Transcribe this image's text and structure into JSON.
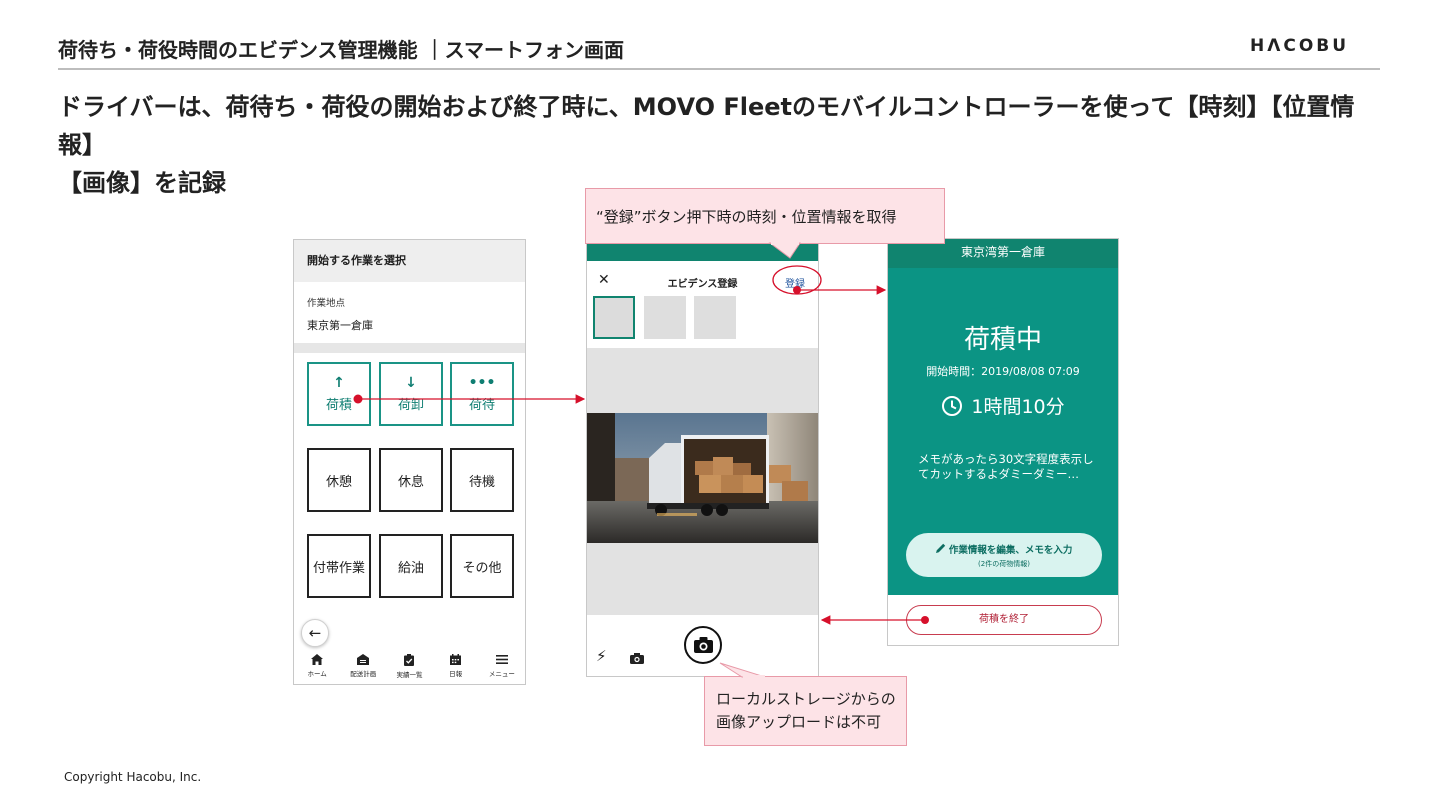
{
  "header": {
    "title": "荷待ち・荷役時間のエビデンス管理機能 ｜スマートフォン画面",
    "brand": "HΛCOBU",
    "headline_line1": "ドライバーは、荷待ち・荷役の開始および終了時に、MOVO Fleetのモバイルコントローラーを使って【時刻】【位置情報】",
    "headline_line2": "【画像】を記録"
  },
  "phone_select": {
    "top_label": "開始する作業を選択",
    "location_label": "作業地点",
    "location_value": "東京第一倉庫",
    "tiles": [
      {
        "label": "荷積",
        "icon": "↑"
      },
      {
        "label": "荷卸",
        "icon": "↓"
      },
      {
        "label": "荷待",
        "icon": "•••"
      },
      {
        "label": "休憩"
      },
      {
        "label": "休息"
      },
      {
        "label": "待機"
      },
      {
        "label": "付帯作業"
      },
      {
        "label": "給油"
      },
      {
        "label": "その他"
      }
    ],
    "back_icon": "←",
    "nav": [
      {
        "label": "ホーム",
        "icon": "home-icon"
      },
      {
        "label": "配送計画",
        "icon": "warehouse-icon"
      },
      {
        "label": "実績一覧",
        "icon": "clipboard-icon"
      },
      {
        "label": "日報",
        "icon": "calendar-icon"
      },
      {
        "label": "メニュー",
        "icon": "menu-icon"
      }
    ]
  },
  "phone_evidence": {
    "close_icon": "✕",
    "title": "エビデンス登録",
    "register_label": "登録",
    "flash_icon": "⚡"
  },
  "phone_status": {
    "location": "東京湾第一倉庫",
    "status": "荷積中",
    "start_time": "開始時間：2019/08/08 07:09",
    "elapsed": "1時間10分",
    "memo": "メモがあったら30文字程度表示してカットするよダミーダミー…",
    "edit_label": "作業情報を編集、メモを入力",
    "edit_sub": "(2件の荷物情報)",
    "finish_label": "荷積を終了"
  },
  "callouts": {
    "register": "“登録”ボタン押下時の時刻・位置情報を取得",
    "upload_line1": "ローカルストレージからの",
    "upload_line2": "画像アップロードは不可"
  },
  "colors": {
    "teal": "#0b9484",
    "teal_dark": "#10846f",
    "arrow_red": "#d6102b",
    "callout_bg": "#fde3e7"
  },
  "footer": {
    "copyright": "Copyright Hacobu, Inc."
  }
}
